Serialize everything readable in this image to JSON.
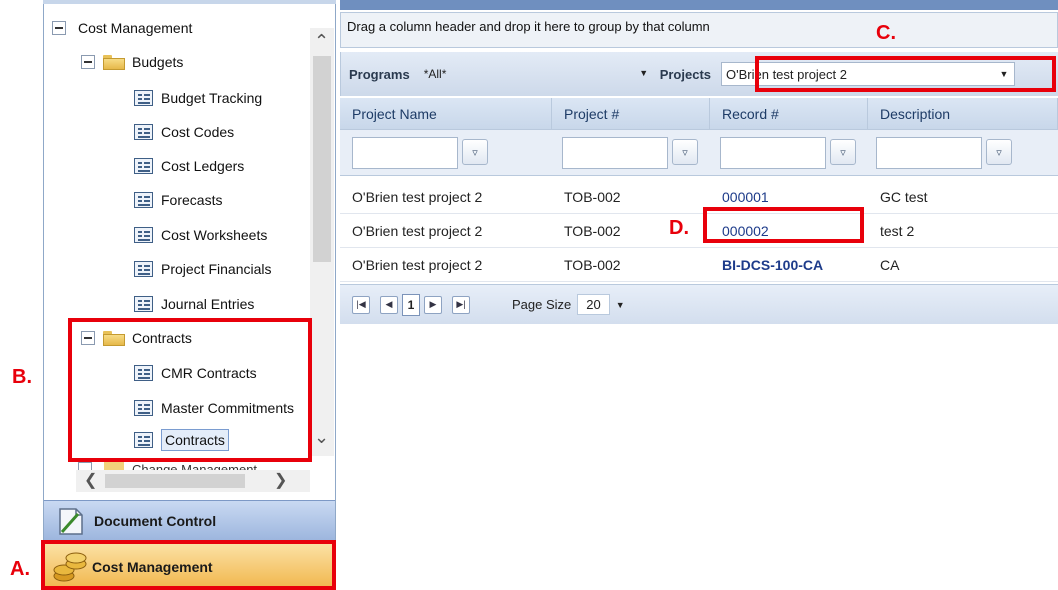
{
  "tree": {
    "root": "Cost Management",
    "budgets": {
      "label": "Budgets",
      "items": [
        "Budget Tracking",
        "Cost Codes",
        "Cost Ledgers",
        "Forecasts",
        "Cost Worksheets",
        "Project Financials",
        "Journal Entries"
      ]
    },
    "contracts": {
      "label": "Contracts",
      "items": [
        "CMR Contracts",
        "Master Commitments",
        "Contracts"
      ]
    },
    "partial": "Change Management"
  },
  "accordion": {
    "document_control": "Document Control",
    "cost_management": "Cost Management"
  },
  "grid": {
    "group_hint": "Drag a column header and drop it here to group by that column",
    "programs_label": "Programs",
    "programs_value": "*All*",
    "projects_label": "Projects",
    "projects_value": "O'Brien test project 2",
    "columns": [
      "Project Name",
      "Project #",
      "Record #",
      "Description"
    ],
    "rows": [
      [
        "O'Brien test project 2",
        "TOB-002",
        "000001",
        "GC test"
      ],
      [
        "O'Brien test project 2",
        "TOB-002",
        "000002",
        "test 2"
      ],
      [
        "O'Brien test project 2",
        "TOB-002",
        "BI-DCS-100-CA",
        "CA"
      ]
    ],
    "pager": {
      "current_page": "1",
      "page_size_label": "Page Size",
      "page_size": "20"
    }
  },
  "annotations": {
    "a": "A.",
    "b": "B.",
    "c": "C.",
    "d": "D."
  },
  "colors": {
    "annotation_red": "#e8000b",
    "link_blue": "#1d3b8a",
    "cost_bar_orange": "#f1b54a",
    "doc_bar_blue": "#9db6de"
  }
}
